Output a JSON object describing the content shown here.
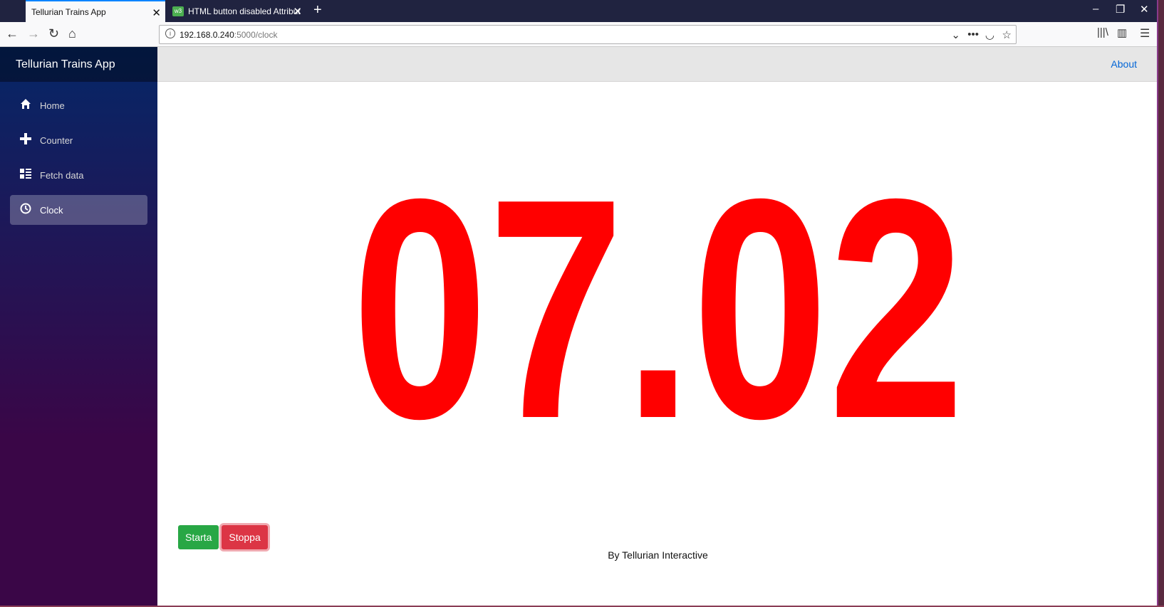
{
  "browser": {
    "tabs": [
      {
        "label": "Tellurian Trains App",
        "active": true
      },
      {
        "label": "HTML button disabled Attribut",
        "active": false
      }
    ],
    "url_host": "192.168.0.240",
    "url_path": ":5000/clock"
  },
  "app": {
    "brand": "Tellurian Trains App",
    "about_label": "About",
    "nav": [
      {
        "label": "Home",
        "icon": "home-icon"
      },
      {
        "label": "Counter",
        "icon": "plus-icon"
      },
      {
        "label": "Fetch data",
        "icon": "list-icon"
      },
      {
        "label": "Clock",
        "icon": "clock-icon",
        "active": true
      }
    ],
    "clock_time": "07.02",
    "clock_color": "#ff0000",
    "start_label": "Starta",
    "stop_label": "Stoppa",
    "footer": "By Tellurian Interactive"
  }
}
